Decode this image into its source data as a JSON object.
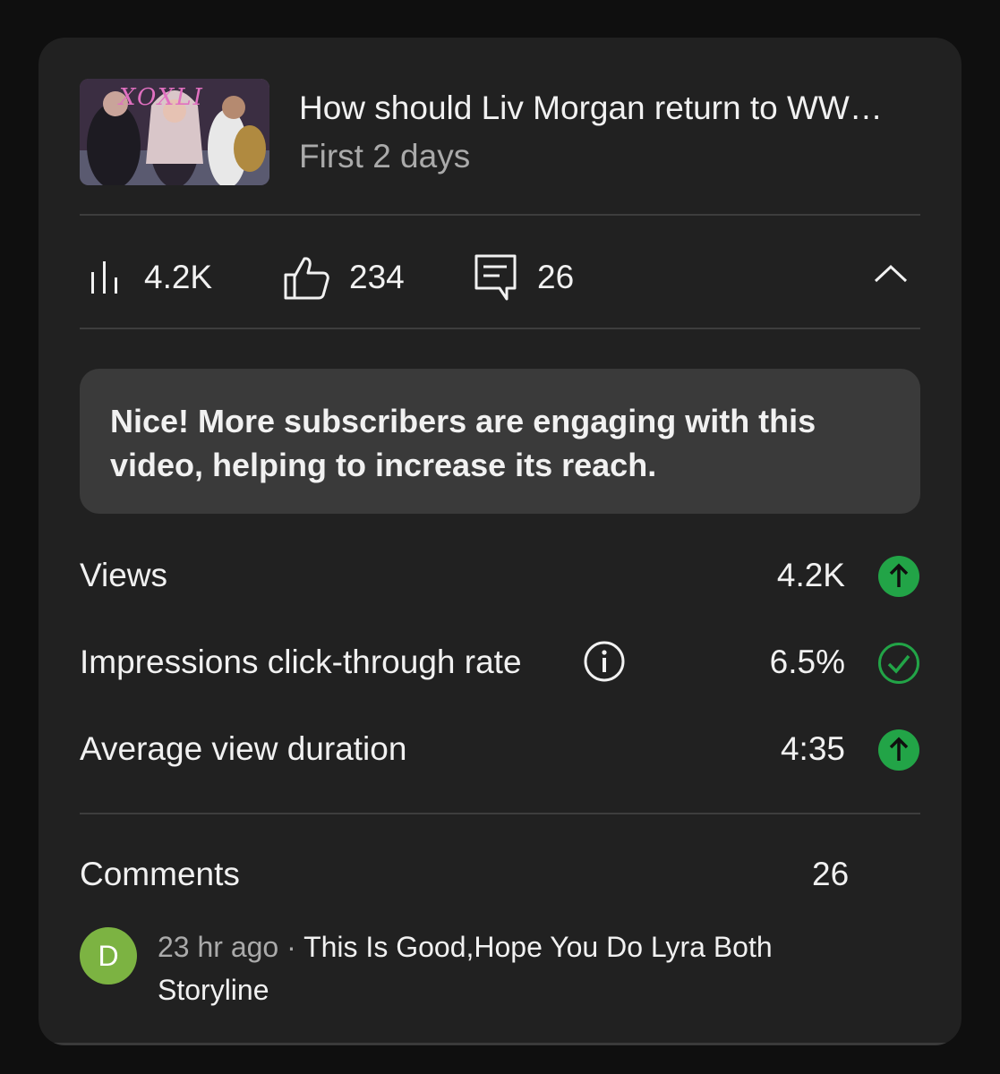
{
  "video": {
    "title": "How should Liv Morgan return to WW…",
    "period": "First 2 days",
    "thumbnail_logo": "XOXLI"
  },
  "stats": {
    "views": "4.2K",
    "likes": "234",
    "comments": "26"
  },
  "tip": {
    "text": "Nice! More subscribers are engaging with this video, helping to increase its reach."
  },
  "metrics": [
    {
      "label": "Views",
      "value": "4.2K",
      "status": "up-arrow"
    },
    {
      "label": "Impressions click-through rate",
      "value": "6.5%",
      "status": "check"
    },
    {
      "label": "Average view duration",
      "value": "4:35",
      "status": "up-arrow"
    }
  ],
  "comments_section": {
    "label": "Comments",
    "count": "26",
    "latest": {
      "avatar_letter": "D",
      "time": "23 hr ago",
      "separator": " · ",
      "text": "This Is Good,Hope You Do Lyra Both Storyline"
    }
  },
  "colors": {
    "accent_green": "#22a447",
    "avatar_green": "#7cb342",
    "card_bg": "#212121",
    "tip_bg": "#3a3a3a"
  }
}
